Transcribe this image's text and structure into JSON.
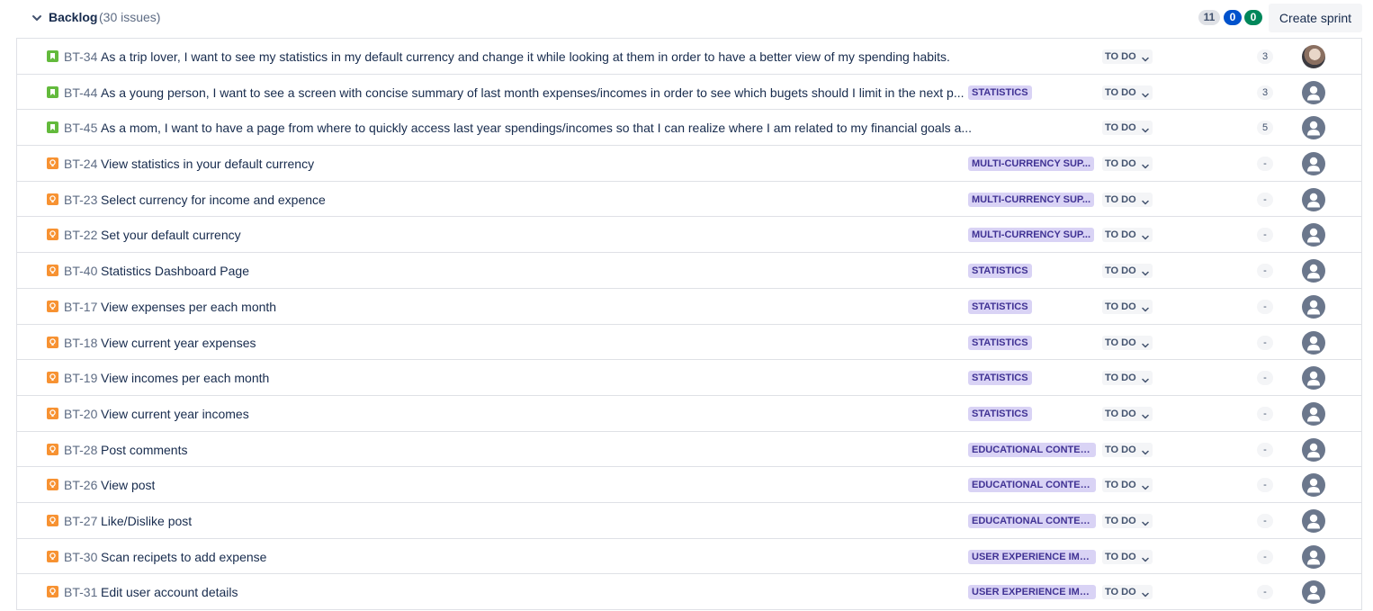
{
  "backlog": {
    "title": "Backlog",
    "issue_count": "(30 issues)",
    "counts": {
      "todo": "11",
      "in_progress": "0",
      "done": "0"
    },
    "create_sprint_label": "Create sprint"
  },
  "colors": {
    "story": "#63ba3c",
    "task": "#f79232",
    "epic_bg": "#d9d3f5",
    "epic_text": "#403294",
    "progress": "#0052cc",
    "done": "#00875a"
  },
  "issues": [
    {
      "type": "story",
      "key": "BT-34",
      "summary": "As a trip lover, I want to see my statistics in my default currency and change it while looking at them in order to have a better view of my spending habits.",
      "epic": "",
      "status": "TO DO",
      "estimate": "3",
      "avatar": "photo"
    },
    {
      "type": "story",
      "key": "BT-44",
      "summary": "As a young person, I want to see a screen with concise summary of last month expenses/incomes in order to see which bugets should I limit in the next p...",
      "epic": "STATISTICS",
      "status": "TO DO",
      "estimate": "3",
      "avatar": "default"
    },
    {
      "type": "story",
      "key": "BT-45",
      "summary": "As a mom, I want to have a page from where to quickly access last year spendings/incomes so that I can realize where I am related to my financial goals a...",
      "epic": "",
      "status": "TO DO",
      "estimate": "5",
      "avatar": "default"
    },
    {
      "type": "task",
      "key": "BT-24",
      "summary": "View statistics in your default currency",
      "epic": "MULTI-CURRENCY SUP...",
      "status": "TO DO",
      "estimate": "-",
      "avatar": "default"
    },
    {
      "type": "task",
      "key": "BT-23",
      "summary": "Select currency for income and expence",
      "epic": "MULTI-CURRENCY SUP...",
      "status": "TO DO",
      "estimate": "-",
      "avatar": "default"
    },
    {
      "type": "task",
      "key": "BT-22",
      "summary": "Set your default currency",
      "epic": "MULTI-CURRENCY SUP...",
      "status": "TO DO",
      "estimate": "-",
      "avatar": "default"
    },
    {
      "type": "task",
      "key": "BT-40",
      "summary": "Statistics Dashboard Page",
      "epic": "STATISTICS",
      "status": "TO DO",
      "estimate": "-",
      "avatar": "default"
    },
    {
      "type": "task",
      "key": "BT-17",
      "summary": "View expenses per each month",
      "epic": "STATISTICS",
      "status": "TO DO",
      "estimate": "-",
      "avatar": "default"
    },
    {
      "type": "task",
      "key": "BT-18",
      "summary": "View current year expenses",
      "epic": "STATISTICS",
      "status": "TO DO",
      "estimate": "-",
      "avatar": "default"
    },
    {
      "type": "task",
      "key": "BT-19",
      "summary": "View incomes per each month",
      "epic": "STATISTICS",
      "status": "TO DO",
      "estimate": "-",
      "avatar": "default"
    },
    {
      "type": "task",
      "key": "BT-20",
      "summary": "View current year incomes",
      "epic": "STATISTICS",
      "status": "TO DO",
      "estimate": "-",
      "avatar": "default"
    },
    {
      "type": "task",
      "key": "BT-28",
      "summary": "Post comments",
      "epic": "EDUCATIONAL CONTENT",
      "status": "TO DO",
      "estimate": "-",
      "avatar": "default"
    },
    {
      "type": "task",
      "key": "BT-26",
      "summary": "View post",
      "epic": "EDUCATIONAL CONTENT",
      "status": "TO DO",
      "estimate": "-",
      "avatar": "default"
    },
    {
      "type": "task",
      "key": "BT-27",
      "summary": "Like/Dislike post",
      "epic": "EDUCATIONAL CONTENT",
      "status": "TO DO",
      "estimate": "-",
      "avatar": "default"
    },
    {
      "type": "task",
      "key": "BT-30",
      "summary": "Scan recipets to add expense",
      "epic": "USER EXPERIENCE IMP...",
      "status": "TO DO",
      "estimate": "-",
      "avatar": "default"
    },
    {
      "type": "task",
      "key": "BT-31",
      "summary": "Edit user account details",
      "epic": "USER EXPERIENCE IMP...",
      "status": "TO DO",
      "estimate": "-",
      "avatar": "default"
    }
  ]
}
